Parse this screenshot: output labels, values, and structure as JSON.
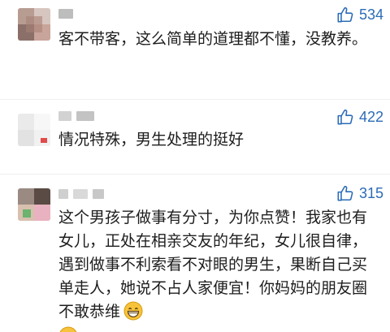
{
  "comments": [
    {
      "likes": "534",
      "text": "客不带客，这么简单的道理都不懂，没教养。"
    },
    {
      "likes": "422",
      "text": "情况特殊，男生处理的挺好"
    },
    {
      "likes": "315",
      "text": "这个男孩子做事有分寸，为你点赞！我家也有女儿，正处在相亲交友的年纪，女儿很自律，遇到做事不利索看不对眼的男生，果断自己买单走人，她说不占人家便宜！你妈妈的朋友圈不敢恭维",
      "trailing_emoji": "grinning-face-emoji"
    }
  ],
  "icons": {
    "like": "thumbs-up-icon"
  },
  "colors": {
    "accent": "#2b6cb7",
    "text": "#1d1d1d",
    "background": "#ffffff"
  }
}
